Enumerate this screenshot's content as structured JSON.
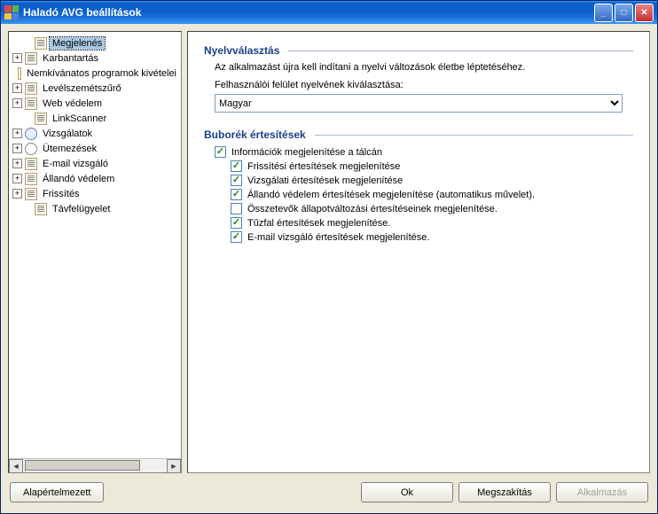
{
  "window": {
    "title": "Haladó AVG beállítások"
  },
  "tree": {
    "items": [
      {
        "label": "Megjelenés",
        "expandable": false,
        "selected": true,
        "icon": "page"
      },
      {
        "label": "Karbantartás",
        "expandable": true,
        "icon": "page"
      },
      {
        "label": "Nemkívánatos programok kivételei",
        "expandable": false,
        "icon": "page"
      },
      {
        "label": "Levélszemétszűrő",
        "expandable": true,
        "icon": "page"
      },
      {
        "label": "Web védelem",
        "expandable": true,
        "icon": "page"
      },
      {
        "label": "LinkScanner",
        "expandable": false,
        "icon": "page"
      },
      {
        "label": "Vizsgálatok",
        "expandable": true,
        "icon": "magnify"
      },
      {
        "label": "Ütemezések",
        "expandable": true,
        "icon": "clock"
      },
      {
        "label": "E-mail vizsgáló",
        "expandable": true,
        "icon": "page"
      },
      {
        "label": "Állandó védelem",
        "expandable": true,
        "icon": "page"
      },
      {
        "label": "Frissítés",
        "expandable": true,
        "icon": "page"
      },
      {
        "label": "Távfelügyelet",
        "expandable": false,
        "icon": "page"
      }
    ]
  },
  "content": {
    "section_lang": "Nyelvválasztás",
    "lang_note": "Az alkalmazást újra kell indítani a nyelvi változások életbe léptetéséhez.",
    "lang_label": "Felhasználói felület nyelvének kiválasztása:",
    "lang_value": "Magyar",
    "section_balloon": "Buborék értesítések",
    "chk_tray": {
      "label": "Információk megjelenítése a tálcán",
      "checked": true
    },
    "sub_checks": [
      {
        "label": "Frissítési értesítések megjelenítése",
        "checked": true
      },
      {
        "label": "Vizsgálati értesítések megjelenítése",
        "checked": true
      },
      {
        "label": "Állandó védelem értesítések megjelenítése (automatikus művelet).",
        "checked": true
      },
      {
        "label": "Összetevők állapotváltozási értesítéseinek megjelenítése.",
        "checked": false
      },
      {
        "label": "Tűzfal értesítések megjelenítése.",
        "checked": true
      },
      {
        "label": "E-mail vizsgáló értesítések megjelenítése.",
        "checked": true
      }
    ]
  },
  "buttons": {
    "default": "Alapértelmezett",
    "ok": "Ok",
    "cancel": "Megszakítás",
    "apply": "Alkalmazás"
  }
}
